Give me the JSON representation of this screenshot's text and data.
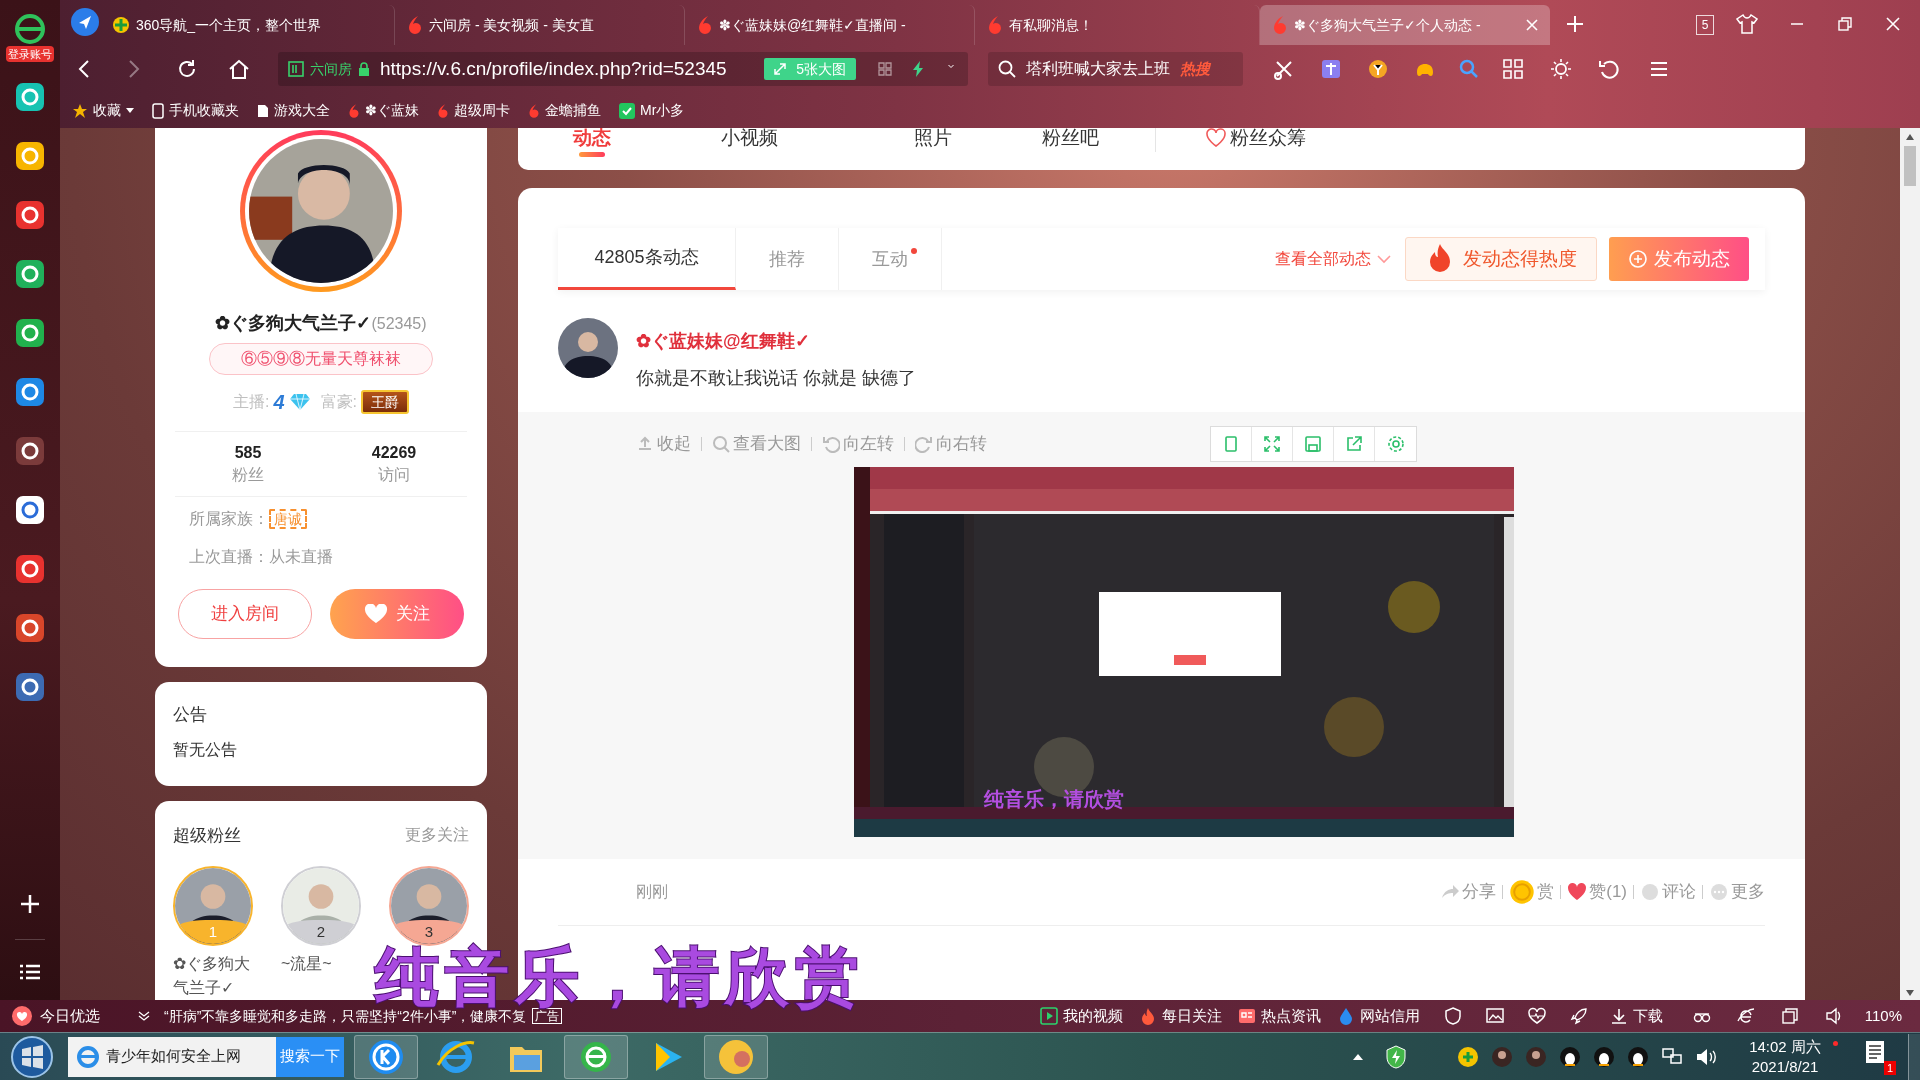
{
  "browser": {
    "sidebar": {
      "login_label": "登录账号"
    },
    "tabs": [
      {
        "title": "360导航_一个主页，整个世界",
        "selected": false
      },
      {
        "title": "六间房 - 美女视频 - 美女直",
        "selected": false
      },
      {
        "title": "✽ぐ蓝妹妹@红舞鞋✓直播间 -",
        "selected": false
      },
      {
        "title": "有私聊消息！",
        "selected": false
      },
      {
        "title": "✽ぐ多狗大气兰子✓个人动态 -",
        "selected": true
      }
    ],
    "tab_count": "5",
    "address": {
      "site_label": "六间房",
      "url": "https://v.6.cn/profile/index.php?rid=52345"
    },
    "images_button": "5张大图",
    "search": {
      "value": "塔利班喊大家去上班",
      "badge": "热搜"
    },
    "bookmarks": [
      "收藏",
      "手机收藏夹",
      "游戏大全",
      "✽ぐ蓝妹",
      "超级周卡",
      "金蟾捕鱼",
      "Mr小多"
    ]
  },
  "nav": [
    {
      "label": "动态",
      "selected": true
    },
    {
      "label": "小视频",
      "selected": false
    },
    {
      "label": "照片",
      "selected": false
    },
    {
      "label": "粉丝吧",
      "selected": false
    },
    {
      "label": "粉丝众筹",
      "selected": false
    }
  ],
  "profile": {
    "name": "✿ぐ多狗大气兰子✓",
    "id": "(52345)",
    "signature": "⑥⑤⑨⑧无量天尊袜袜",
    "anchor_label": "主播:",
    "anchor_level": "4",
    "rich_label": "富豪:",
    "rich_badge": "王爵",
    "stats": [
      {
        "value": "585",
        "label": "粉丝"
      },
      {
        "value": "42269",
        "label": "访问"
      }
    ],
    "family_label": "所属家族：",
    "family_badge": "唐诚",
    "last_live": "上次直播：从未直播",
    "enter_button": "进入房间",
    "follow_button": "关注"
  },
  "notice": {
    "title": "公告",
    "text": "暂无公告"
  },
  "super_fans": {
    "title": "超级粉丝",
    "more": "更多关注",
    "fans": [
      {
        "rank": "1",
        "name": "✿ぐ多狗大气兰子✓",
        "color": "#f8b42c"
      },
      {
        "rank": "2",
        "name": "~流星~",
        "color": "#cfcfd4"
      },
      {
        "rank": "3",
        "color": "#f5a793"
      }
    ]
  },
  "feed": {
    "tabs": [
      {
        "label": "42805条动态",
        "selected": true,
        "notification_dot": false
      },
      {
        "label": "推荐",
        "selected": false,
        "notification_dot": false
      },
      {
        "label": "互动",
        "selected": false,
        "notification_dot": true
      }
    ],
    "view_all": "查看全部动态",
    "hot_button": "发动态得热度",
    "publish_button": "发布动态",
    "posts": [
      {
        "author": "✿ぐ蓝妹妹@红舞鞋✓",
        "text": "你就是不敢让我说话 你就是 缺德了",
        "image_tools": [
          "收起",
          "查看大图",
          "向左转",
          "向右转"
        ],
        "image_caption": "纯音乐，请欣赏",
        "time": "刚刚",
        "actions": [
          "分享",
          "赏",
          "赞(1)",
          "评论",
          "更多"
        ]
      }
    ]
  },
  "caption": "纯音乐，请欣赏",
  "status_bar": {
    "promo_label": "今日优选",
    "ad_text": "“肝病”不靠多睡觉和多走路，只需坚持“2件小事”，健康不复",
    "ad_tag": "广告",
    "items": [
      "我的视频",
      "每日关注",
      "热点资讯",
      "网站信用",
      "下载"
    ],
    "zoom": "110%"
  },
  "taskbar": {
    "search_value": "青少年如何安全上网",
    "search_button": "搜索一下",
    "time": "14:02 周六",
    "date": "2021/8/21",
    "notification_count": "1"
  }
}
